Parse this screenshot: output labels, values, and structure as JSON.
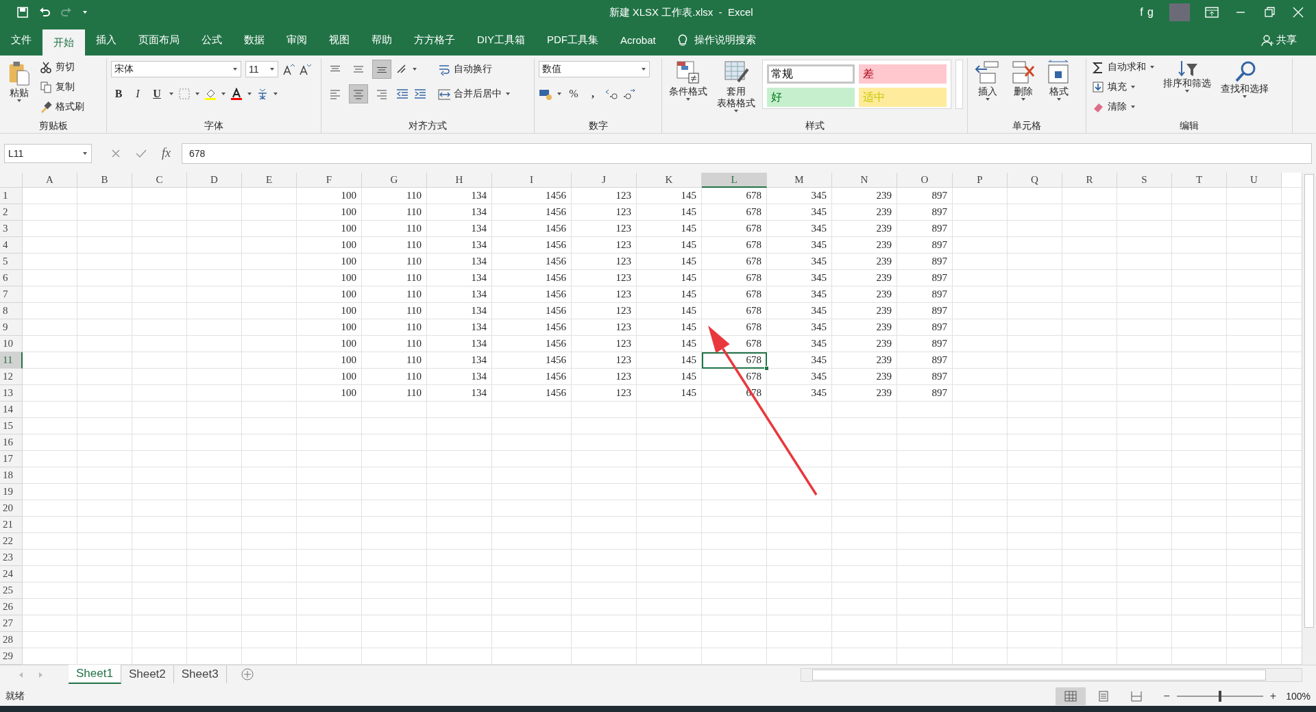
{
  "window": {
    "title": "新建 XLSX 工作表.xlsx  -  Excel",
    "user": "f g"
  },
  "tabs": [
    {
      "label": "文件",
      "selected": false
    },
    {
      "label": "开始",
      "selected": true
    },
    {
      "label": "插入",
      "selected": false
    },
    {
      "label": "页面布局",
      "selected": false
    },
    {
      "label": "公式",
      "selected": false
    },
    {
      "label": "数据",
      "selected": false
    },
    {
      "label": "审阅",
      "selected": false
    },
    {
      "label": "视图",
      "selected": false
    },
    {
      "label": "帮助",
      "selected": false
    },
    {
      "label": "方方格子",
      "selected": false
    },
    {
      "label": "DIY工具箱",
      "selected": false
    },
    {
      "label": "PDF工具集",
      "selected": false
    },
    {
      "label": "Acrobat",
      "selected": false
    }
  ],
  "tell_me": "操作说明搜索",
  "share": "共享",
  "ribbon": {
    "clipboard": {
      "title": "剪贴板",
      "paste": "粘贴",
      "cut": "剪切",
      "copy": "复制",
      "format_painter": "格式刷"
    },
    "font": {
      "title": "字体",
      "font_name": "宋体",
      "font_size": "11",
      "bold": "B",
      "italic": "I",
      "underline": "U"
    },
    "alignment": {
      "title": "对齐方式",
      "wrap_text": "自动换行",
      "merge_center": "合并后居中",
      "vertical_align": [
        {
          "selected": false
        },
        {
          "selected": false
        },
        {
          "selected": true
        }
      ],
      "horizontal_align": [
        {
          "selected": false
        },
        {
          "selected": true
        },
        {
          "selected": false
        }
      ]
    },
    "number": {
      "title": "数字",
      "format": "数值",
      "percent": "%",
      "comma": ","
    },
    "styles": {
      "title": "样式",
      "conditional": "条件格式",
      "table_format": [
        "套用",
        "表格格式"
      ],
      "cell_styles": [
        {
          "label": "常规",
          "color": "#ffffff"
        },
        {
          "label": "差",
          "color": "#ffc7ce"
        },
        {
          "label": "好",
          "color": "#c6efce"
        },
        {
          "label": "适中",
          "color": "#ffeb9c"
        }
      ]
    },
    "cells": {
      "title": "单元格",
      "insert": "插入",
      "delete": "删除",
      "format": "格式"
    },
    "editing": {
      "title": "编辑",
      "autosum": "自动求和",
      "fill": "填充",
      "clear": "清除",
      "sort": "排序和筛选",
      "find": "查找和选择"
    }
  },
  "formula_bar": {
    "name_box": "L11",
    "function_label": "fx",
    "formula": "678"
  },
  "sheet": {
    "columns": [
      {
        "letter": "A",
        "selected": false
      },
      {
        "letter": "B",
        "selected": false
      },
      {
        "letter": "C",
        "selected": false
      },
      {
        "letter": "D",
        "selected": false
      },
      {
        "letter": "E",
        "selected": false
      },
      {
        "letter": "F",
        "selected": false
      },
      {
        "letter": "G",
        "selected": false
      },
      {
        "letter": "H",
        "selected": false
      },
      {
        "letter": "I",
        "selected": false
      },
      {
        "letter": "J",
        "selected": false
      },
      {
        "letter": "K",
        "selected": false
      },
      {
        "letter": "L",
        "selected": true
      },
      {
        "letter": "M",
        "selected": false
      },
      {
        "letter": "N",
        "selected": false
      },
      {
        "letter": "O",
        "selected": false
      },
      {
        "letter": "P",
        "selected": false
      },
      {
        "letter": "Q",
        "selected": false
      },
      {
        "letter": "R",
        "selected": false
      },
      {
        "letter": "S",
        "selected": false
      },
      {
        "letter": "T",
        "selected": false
      },
      {
        "letter": "U",
        "selected": false
      }
    ],
    "rows": [
      {
        "header": "1",
        "selected": false,
        "cells": {
          "F": "100",
          "G": "110",
          "H": "134",
          "I": "1456",
          "J": "123",
          "K": "145",
          "L": "678",
          "M": "345",
          "N": "239",
          "O": "897"
        }
      },
      {
        "header": "2",
        "selected": false,
        "cells": {
          "F": "100",
          "G": "110",
          "H": "134",
          "I": "1456",
          "J": "123",
          "K": "145",
          "L": "678",
          "M": "345",
          "N": "239",
          "O": "897"
        }
      },
      {
        "header": "3",
        "selected": false,
        "cells": {
          "F": "100",
          "G": "110",
          "H": "134",
          "I": "1456",
          "J": "123",
          "K": "145",
          "L": "678",
          "M": "345",
          "N": "239",
          "O": "897"
        }
      },
      {
        "header": "4",
        "selected": false,
        "cells": {
          "F": "100",
          "G": "110",
          "H": "134",
          "I": "1456",
          "J": "123",
          "K": "145",
          "L": "678",
          "M": "345",
          "N": "239",
          "O": "897"
        }
      },
      {
        "header": "5",
        "selected": false,
        "cells": {
          "F": "100",
          "G": "110",
          "H": "134",
          "I": "1456",
          "J": "123",
          "K": "145",
          "L": "678",
          "M": "345",
          "N": "239",
          "O": "897"
        }
      },
      {
        "header": "6",
        "selected": false,
        "cells": {
          "F": "100",
          "G": "110",
          "H": "134",
          "I": "1456",
          "J": "123",
          "K": "145",
          "L": "678",
          "M": "345",
          "N": "239",
          "O": "897"
        }
      },
      {
        "header": "7",
        "selected": false,
        "cells": {
          "F": "100",
          "G": "110",
          "H": "134",
          "I": "1456",
          "J": "123",
          "K": "145",
          "L": "678",
          "M": "345",
          "N": "239",
          "O": "897"
        }
      },
      {
        "header": "8",
        "selected": false,
        "cells": {
          "F": "100",
          "G": "110",
          "H": "134",
          "I": "1456",
          "J": "123",
          "K": "145",
          "L": "678",
          "M": "345",
          "N": "239",
          "O": "897"
        }
      },
      {
        "header": "9",
        "selected": false,
        "cells": {
          "F": "100",
          "G": "110",
          "H": "134",
          "I": "1456",
          "J": "123",
          "K": "145",
          "L": "678",
          "M": "345",
          "N": "239",
          "O": "897"
        }
      },
      {
        "header": "10",
        "selected": false,
        "cells": {
          "F": "100",
          "G": "110",
          "H": "134",
          "I": "1456",
          "J": "123",
          "K": "145",
          "L": "678",
          "M": "345",
          "N": "239",
          "O": "897"
        }
      },
      {
        "header": "11",
        "selected": true,
        "cells": {
          "F": "100",
          "G": "110",
          "H": "134",
          "I": "1456",
          "J": "123",
          "K": "145",
          "L": "678",
          "M": "345",
          "N": "239",
          "O": "897"
        }
      },
      {
        "header": "12",
        "selected": false,
        "cells": {
          "F": "100",
          "G": "110",
          "H": "134",
          "I": "1456",
          "J": "123",
          "K": "145",
          "L": "678",
          "M": "345",
          "N": "239",
          "O": "897"
        }
      },
      {
        "header": "13",
        "selected": false,
        "cells": {
          "F": "100",
          "G": "110",
          "H": "134",
          "I": "1456",
          "J": "123",
          "K": "145",
          "L": "678",
          "M": "345",
          "N": "239",
          "O": "897"
        }
      },
      {
        "header": "14",
        "selected": false
      },
      {
        "header": "15",
        "selected": false
      },
      {
        "header": "16",
        "selected": false
      },
      {
        "header": "17",
        "selected": false
      },
      {
        "header": "18",
        "selected": false
      },
      {
        "header": "19",
        "selected": false
      },
      {
        "header": "20",
        "selected": false
      },
      {
        "header": "21",
        "selected": false
      },
      {
        "header": "22",
        "selected": false
      },
      {
        "header": "23",
        "selected": false
      },
      {
        "header": "24",
        "selected": false
      },
      {
        "header": "25",
        "selected": false
      },
      {
        "header": "26",
        "selected": false
      },
      {
        "header": "27",
        "selected": false
      },
      {
        "header": "28",
        "selected": false
      },
      {
        "header": "29",
        "selected": false
      }
    ]
  },
  "sheet_tabs": [
    {
      "label": "Sheet1",
      "selected": true
    },
    {
      "label": "Sheet2",
      "selected": false
    },
    {
      "label": "Sheet3",
      "selected": false
    }
  ],
  "status_bar": {
    "text": "就绪",
    "views": [
      {
        "selected": true
      },
      {
        "selected": false
      },
      {
        "selected": false
      }
    ],
    "zoom_out": "−",
    "zoom_in": "+",
    "zoom_slider": {
      "level": 0.5
    },
    "zoom": "100%"
  }
}
